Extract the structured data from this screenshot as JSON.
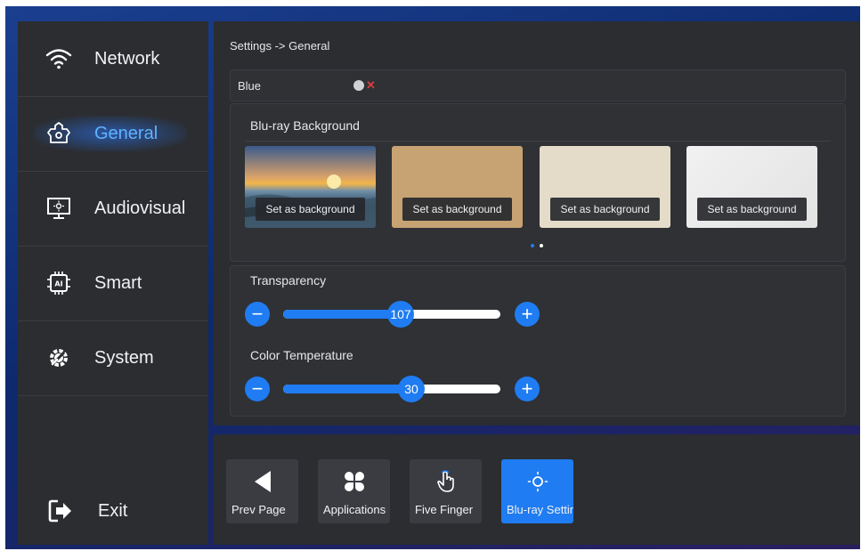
{
  "sidebar": {
    "items": [
      {
        "label": "Network",
        "icon": "wifi-icon"
      },
      {
        "label": "General",
        "icon": "general-settings-icon",
        "active": true
      },
      {
        "label": "Audiovisual",
        "icon": "monitor-icon"
      },
      {
        "label": "Smart",
        "icon": "ai-chip-icon"
      },
      {
        "label": "System",
        "icon": "system-gear-icon"
      }
    ],
    "exit": {
      "label": "Exit",
      "icon": "exit-icon"
    }
  },
  "main": {
    "breadcrumb": "Settings -> General",
    "blue": {
      "label": "Blue",
      "enabled": false
    },
    "background": {
      "title": "Blu-ray Background",
      "set_label": "Set as background",
      "thumbnails": [
        "sunset-seascape",
        "kraft-paper",
        "beige-texture",
        "white-texture"
      ],
      "page_count": 2,
      "current_page": 1
    },
    "transparency": {
      "label": "Transparency",
      "value": "107",
      "fraction": 0.54
    },
    "color_temperature": {
      "label": "Color Temperature",
      "value": "30",
      "fraction": 0.59
    }
  },
  "dock": {
    "items": [
      {
        "label": "Prev Page",
        "icon": "back-triangle-icon"
      },
      {
        "label": "Applications",
        "icon": "apps-clover-icon"
      },
      {
        "label": "Five Finger",
        "icon": "hand-pointer-icon"
      },
      {
        "label": "Blu-ray Settings",
        "icon": "brightness-icon",
        "active": true
      }
    ]
  },
  "colors": {
    "accent": "#1f7cf2",
    "panel": "#2b2d31",
    "active_nav": "#5fb2ff"
  }
}
